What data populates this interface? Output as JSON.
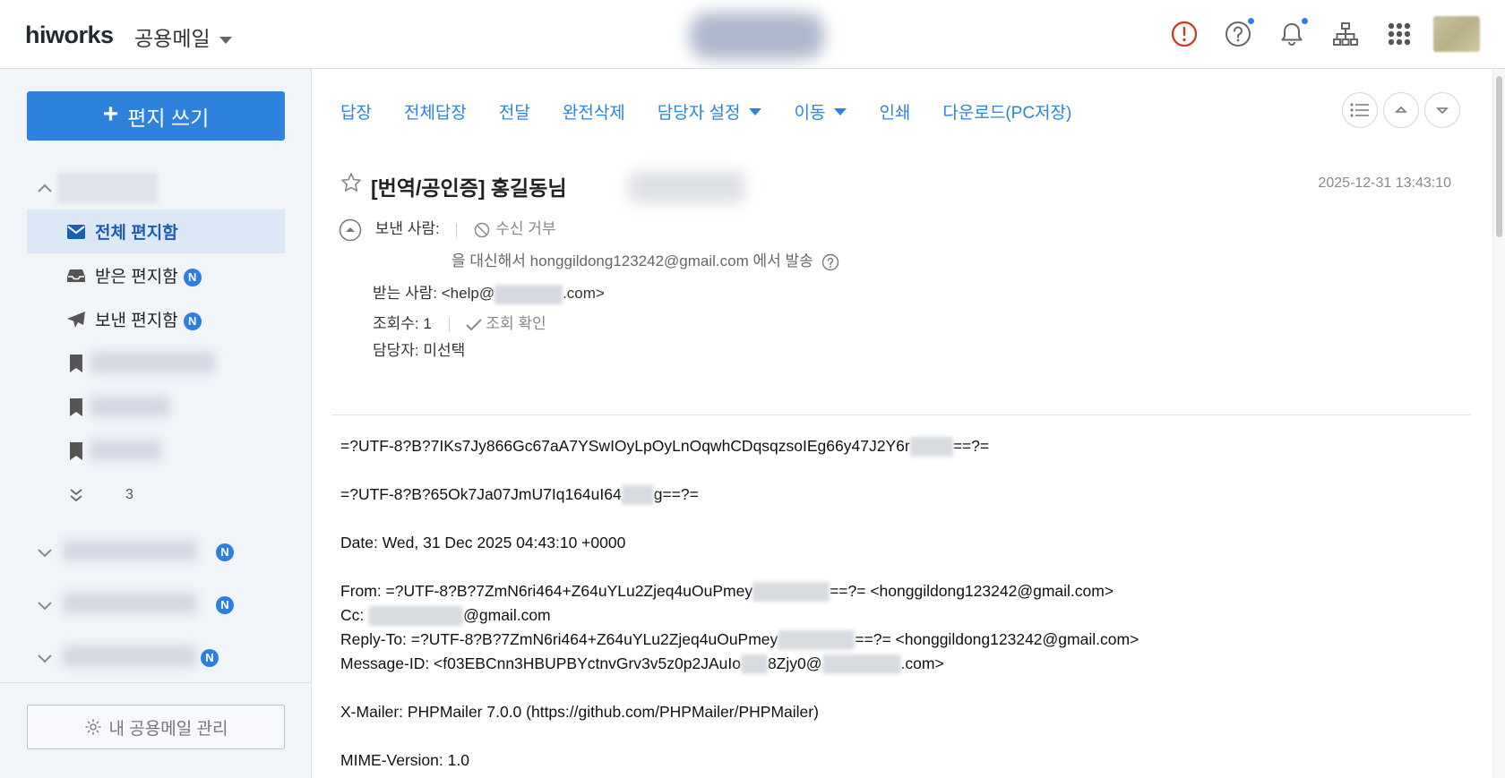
{
  "header": {
    "logo": "hiworks",
    "app_switch": "공용메일",
    "icons": [
      "alert-icon",
      "help-icon",
      "bell-icon",
      "org-chart-icon",
      "apps-grid-icon"
    ]
  },
  "sidebar": {
    "compose_label": "편지 쓰기",
    "folders": [
      {
        "label": "전체 편지함",
        "icon": "envelope-icon",
        "active": true
      },
      {
        "label": "받은 편지함",
        "icon": "inbox-icon",
        "badge": "N"
      },
      {
        "label": "보낸 편지함",
        "icon": "paper-plane-icon",
        "badge": "N"
      }
    ],
    "more_count": "3",
    "shared_badges": [
      "N",
      "N",
      "N"
    ],
    "manage_label": "내 공용메일 관리"
  },
  "toolbar": {
    "reply": "답장",
    "reply_all": "전체답장",
    "forward": "전달",
    "delete_perm": "완전삭제",
    "assign": "담당자 설정",
    "move": "이동",
    "print": "인쇄",
    "download": "다운로드(PC저장)"
  },
  "message": {
    "subject": "[번역/공인증] 홍길동님",
    "date": "2025-12-31 13:43:10",
    "sender_label": "보낸 사람:",
    "block_label": "수신 거부",
    "on_behalf_prefix": "을 대신해서",
    "on_behalf_email": "honggildong123242@gmail.com",
    "on_behalf_suffix": "에서 발송",
    "to_label": "받는 사람:",
    "to_prefix": "<help@",
    "to_suffix": ".com>",
    "views_label": "조회수:",
    "views_value": "1",
    "read_check": "조회 확인",
    "assignee_label": "담당자:",
    "assignee_value": "미선택"
  },
  "body": {
    "line1a": "=?UTF-8?B?7IKs7Jy866Gc67aA7YSwIOyLpOyLnOqwhCDqsqzsoIEg66y47J2Y6r",
    "line1b": "==?=",
    "line2a": "=?UTF-8?B?65Ok7Ja07JmU7Iq164uI64",
    "line2b": "g==?=",
    "date_line": "Date: Wed, 31 Dec 2025 04:43:10 +0000",
    "from_a": "From: =?UTF-8?B?7ZmN6ri464+Z64uYLu2Zjeq4uOuPmey",
    "from_b": "==?=  <honggildong123242@gmail.com>",
    "cc_a": "Cc: ",
    "cc_b": "@gmail.com",
    "reply_a": "Reply-To: =?UTF-8?B?7ZmN6ri464+Z64uYLu2Zjeq4uOuPmey",
    "reply_b": "==?=  <honggildong123242@gmail.com>",
    "msgid_a": "Message-ID: <f03EBCnn3HBUPBYctnvGrv3v5z0p2JAuIo",
    "msgid_b": "8Zjy0@",
    "msgid_c": ".com>",
    "xmailer": "X-Mailer: PHPMailer 7.0.0 (https://github.com/PHPMailer/PHPMailer)",
    "mime": "MIME-Version: 1.0"
  },
  "colors": {
    "accent": "#2e82dd",
    "badge": "#2f7fe0",
    "sidebar_bg": "#f1f4f9",
    "active_row": "#dce8f7",
    "alert": "#d93025"
  }
}
